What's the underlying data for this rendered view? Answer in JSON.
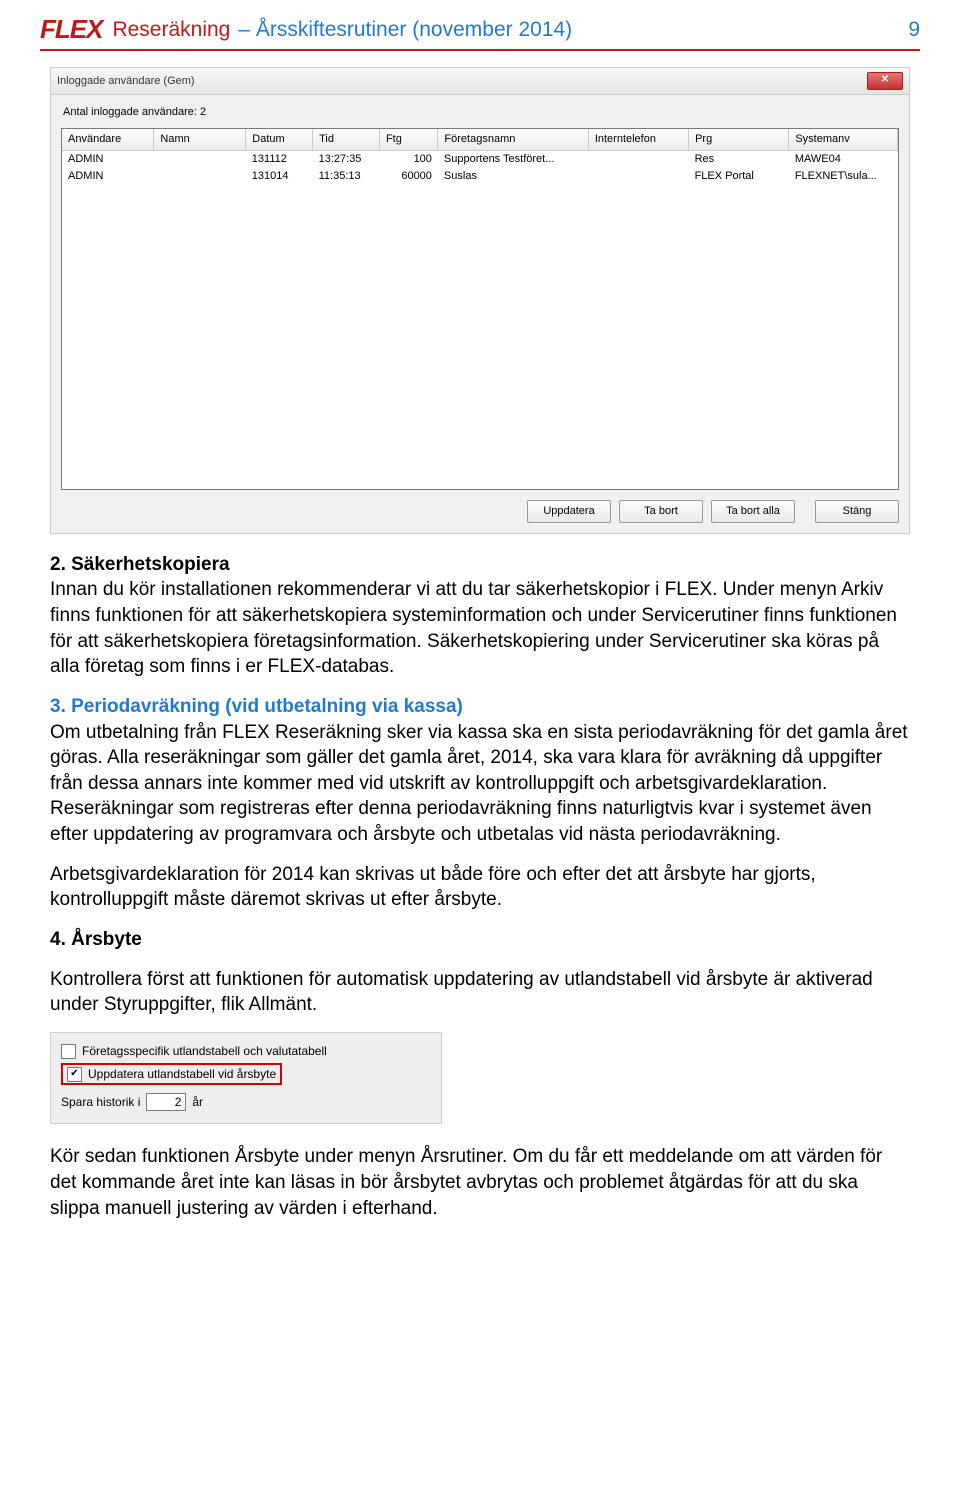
{
  "header": {
    "logo": "FLEX",
    "title": "Reseräkning",
    "subtitle": "– Årsskiftesrutiner (november 2014)",
    "page_number": "9"
  },
  "dialog": {
    "title": "Inloggade användare (Gem)",
    "count_label": "Antal inloggade användare: 2",
    "columns": [
      "Användare",
      "Namn",
      "Datum",
      "Tid",
      "Ftg",
      "Företagsnamn",
      "Interntelefon",
      "Prg",
      "Systemanv"
    ],
    "rows": [
      {
        "user": "ADMIN",
        "name": "",
        "date": "131112",
        "time": "13:27:35",
        "ftg": "100",
        "company": "Supportens Testföret...",
        "tel": "",
        "prg": "Res",
        "sys": "MAWE04"
      },
      {
        "user": "ADMIN",
        "name": "",
        "date": "131014",
        "time": "11:35:13",
        "ftg": "60000",
        "company": "Suslas",
        "tel": "",
        "prg": "FLEX Portal",
        "sys": "FLEXNET\\sula..."
      }
    ],
    "buttons": {
      "update": "Uppdatera",
      "remove": "Ta bort",
      "remove_all": "Ta bort alla",
      "close": "Stäng"
    }
  },
  "body": {
    "sec2": {
      "title": "2. Säkerhetskopiera",
      "p1": "Innan du kör installationen rekommenderar vi att du tar säkerhetskopior i FLEX. Under menyn Arkiv finns funktionen för att säkerhetskopiera systeminformation och under Servicerutiner finns funktionen för att säkerhetskopiera företagsinformation. Säkerhetskopiering under Servicerutiner ska köras på alla företag som finns i er FLEX-databas."
    },
    "sec3": {
      "title": "3. Periodavräkning (vid utbetalning via kassa)",
      "p1": "Om utbetalning från FLEX Reseräkning sker via kassa ska en sista periodavräkning för det gamla året göras. Alla reseräkningar som gäller det gamla året, 2014, ska vara klara för avräkning då uppgifter från dessa annars inte kommer med vid utskrift av kontrolluppgift och arbetsgivardeklaration. Reseräkningar som registreras efter denna periodavräkning finns naturligtvis kvar i systemet även efter uppdatering av programvara och årsbyte och utbetalas vid nästa periodavräkning.",
      "p2": "Arbetsgivardeklaration för 2014 kan skrivas ut både före och efter det att årsbyte har gjorts, kontrolluppgift måste däremot skrivas ut efter årsbyte."
    },
    "sec4": {
      "title": "4. Årsbyte",
      "p1": "Kontrollera först att funktionen för automatisk uppdatering av utlandstabell vid årsbyte är aktiverad under Styruppgifter, flik Allmänt.",
      "p2": "Kör sedan funktionen Årsbyte under menyn Årsrutiner. Om du får ett meddelande om att värden för det kommande året inte kan läsas in bör årsbytet avbrytas och problemet åtgärdas för att du ska slippa manuell justering av värden i efterhand."
    }
  },
  "settings": {
    "opt1": "Företagsspecifik utlandstabell och valutatabell",
    "opt2": "Uppdatera utlandstabell vid årsbyte",
    "opt3_pre": "Spara historik i",
    "opt3_val": "2",
    "opt3_post": "år"
  }
}
